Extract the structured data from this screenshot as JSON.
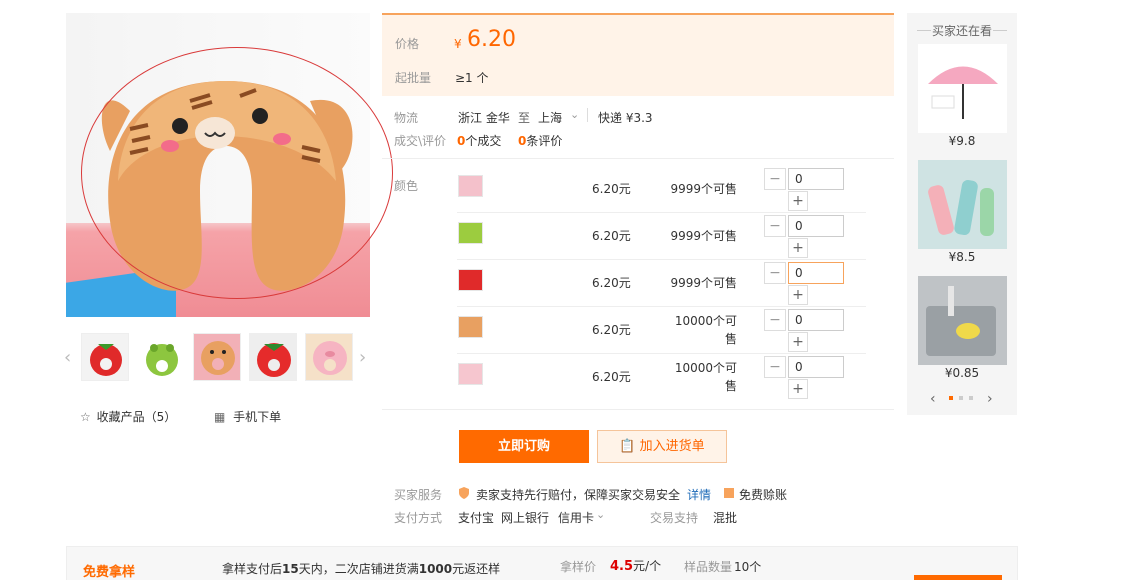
{
  "gallery": {
    "favorite_label": "收藏产品（5）",
    "mobile_order_label": "手机下单"
  },
  "price": {
    "label": "价格",
    "currency": "¥",
    "value": "6.20",
    "moq_label": "起批量",
    "moq_value": "≥1 个"
  },
  "shipping": {
    "label": "物流",
    "from": "浙江 金华",
    "to_word": "至",
    "to": "上海",
    "method": "快递 ¥3.3"
  },
  "deals": {
    "label": "成交\\评价",
    "deals_count": "0",
    "deals_unit": "个成交",
    "reviews_count": "0",
    "reviews_unit": "条评价"
  },
  "variants": {
    "label": "颜色",
    "rows": [
      {
        "price": "6.20元",
        "stock": "9999个可售",
        "qty": "0"
      },
      {
        "price": "6.20元",
        "stock": "9999个可售",
        "qty": "0"
      },
      {
        "price": "6.20元",
        "stock": "9999个可售",
        "qty": "0"
      },
      {
        "price": "6.20元",
        "stock": "10000个可售",
        "qty": "0"
      },
      {
        "price": "6.20元",
        "stock": "10000个可售",
        "qty": "0"
      }
    ]
  },
  "actions": {
    "order_label": "立即订购",
    "cart_label": "加入进货单"
  },
  "service": {
    "label": "买家服务",
    "text": "卖家支持先行赔付，保障买家交易安全",
    "detail_link": "详情",
    "free_label": "免费赊账"
  },
  "payment": {
    "label": "支付方式",
    "methods": [
      "支付宝",
      "网上银行",
      "信用卡"
    ],
    "trade_label": "交易支持",
    "trade_value": "混批"
  },
  "recommend": {
    "title": "买家还在看",
    "items": [
      {
        "price": "¥9.8"
      },
      {
        "price": "¥8.5"
      },
      {
        "price": "¥0.85"
      }
    ]
  },
  "sample": {
    "logo": "免费拿样",
    "text_prefix": "拿样支付后",
    "days": "15",
    "text_mid": "天内，二次店铺进货满",
    "amount": "1000",
    "text_suffix": "元返还样",
    "price_label": "拿样价",
    "price_value": "4.5",
    "price_unit": "元/个",
    "count_label": "样品数量",
    "count_value": "10个"
  },
  "colors": {
    "accent": "#ff6a00",
    "price": "#ff6600",
    "annotation": "#d93a3a"
  }
}
